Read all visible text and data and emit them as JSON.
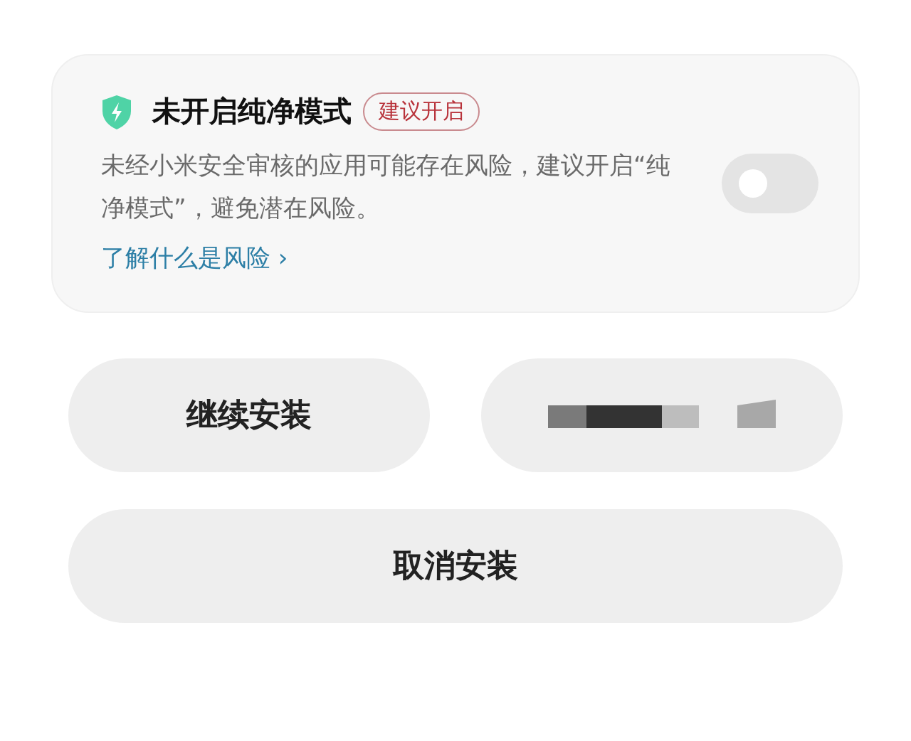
{
  "card": {
    "title": "未开启纯净模式",
    "badge": "建议开启",
    "description": "未经小米安全审核的应用可能存在风险，建议开启“纯净模式”，避免潜在风险。",
    "link": "了解什么是风险",
    "link_arrow": "›",
    "toggle": {
      "on": false
    }
  },
  "buttons": [
    {
      "kind": "text",
      "label": "继续安装"
    },
    {
      "kind": "redacted"
    }
  ],
  "cancel_button": {
    "label": "取消安装"
  }
}
